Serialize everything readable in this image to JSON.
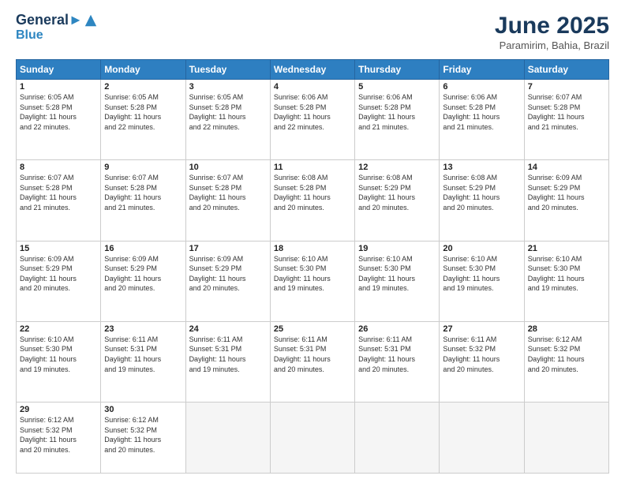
{
  "header": {
    "logo_line1": "General",
    "logo_line2": "Blue",
    "month": "June 2025",
    "location": "Paramirim, Bahia, Brazil"
  },
  "weekdays": [
    "Sunday",
    "Monday",
    "Tuesday",
    "Wednesday",
    "Thursday",
    "Friday",
    "Saturday"
  ],
  "weeks": [
    [
      {
        "day": 1,
        "info": "Sunrise: 6:05 AM\nSunset: 5:28 PM\nDaylight: 11 hours\nand 22 minutes."
      },
      {
        "day": 2,
        "info": "Sunrise: 6:05 AM\nSunset: 5:28 PM\nDaylight: 11 hours\nand 22 minutes."
      },
      {
        "day": 3,
        "info": "Sunrise: 6:05 AM\nSunset: 5:28 PM\nDaylight: 11 hours\nand 22 minutes."
      },
      {
        "day": 4,
        "info": "Sunrise: 6:06 AM\nSunset: 5:28 PM\nDaylight: 11 hours\nand 22 minutes."
      },
      {
        "day": 5,
        "info": "Sunrise: 6:06 AM\nSunset: 5:28 PM\nDaylight: 11 hours\nand 21 minutes."
      },
      {
        "day": 6,
        "info": "Sunrise: 6:06 AM\nSunset: 5:28 PM\nDaylight: 11 hours\nand 21 minutes."
      },
      {
        "day": 7,
        "info": "Sunrise: 6:07 AM\nSunset: 5:28 PM\nDaylight: 11 hours\nand 21 minutes."
      }
    ],
    [
      {
        "day": 8,
        "info": "Sunrise: 6:07 AM\nSunset: 5:28 PM\nDaylight: 11 hours\nand 21 minutes."
      },
      {
        "day": 9,
        "info": "Sunrise: 6:07 AM\nSunset: 5:28 PM\nDaylight: 11 hours\nand 21 minutes."
      },
      {
        "day": 10,
        "info": "Sunrise: 6:07 AM\nSunset: 5:28 PM\nDaylight: 11 hours\nand 20 minutes."
      },
      {
        "day": 11,
        "info": "Sunrise: 6:08 AM\nSunset: 5:28 PM\nDaylight: 11 hours\nand 20 minutes."
      },
      {
        "day": 12,
        "info": "Sunrise: 6:08 AM\nSunset: 5:29 PM\nDaylight: 11 hours\nand 20 minutes."
      },
      {
        "day": 13,
        "info": "Sunrise: 6:08 AM\nSunset: 5:29 PM\nDaylight: 11 hours\nand 20 minutes."
      },
      {
        "day": 14,
        "info": "Sunrise: 6:09 AM\nSunset: 5:29 PM\nDaylight: 11 hours\nand 20 minutes."
      }
    ],
    [
      {
        "day": 15,
        "info": "Sunrise: 6:09 AM\nSunset: 5:29 PM\nDaylight: 11 hours\nand 20 minutes."
      },
      {
        "day": 16,
        "info": "Sunrise: 6:09 AM\nSunset: 5:29 PM\nDaylight: 11 hours\nand 20 minutes."
      },
      {
        "day": 17,
        "info": "Sunrise: 6:09 AM\nSunset: 5:29 PM\nDaylight: 11 hours\nand 20 minutes."
      },
      {
        "day": 18,
        "info": "Sunrise: 6:10 AM\nSunset: 5:30 PM\nDaylight: 11 hours\nand 19 minutes."
      },
      {
        "day": 19,
        "info": "Sunrise: 6:10 AM\nSunset: 5:30 PM\nDaylight: 11 hours\nand 19 minutes."
      },
      {
        "day": 20,
        "info": "Sunrise: 6:10 AM\nSunset: 5:30 PM\nDaylight: 11 hours\nand 19 minutes."
      },
      {
        "day": 21,
        "info": "Sunrise: 6:10 AM\nSunset: 5:30 PM\nDaylight: 11 hours\nand 19 minutes."
      }
    ],
    [
      {
        "day": 22,
        "info": "Sunrise: 6:10 AM\nSunset: 5:30 PM\nDaylight: 11 hours\nand 19 minutes."
      },
      {
        "day": 23,
        "info": "Sunrise: 6:11 AM\nSunset: 5:31 PM\nDaylight: 11 hours\nand 19 minutes."
      },
      {
        "day": 24,
        "info": "Sunrise: 6:11 AM\nSunset: 5:31 PM\nDaylight: 11 hours\nand 19 minutes."
      },
      {
        "day": 25,
        "info": "Sunrise: 6:11 AM\nSunset: 5:31 PM\nDaylight: 11 hours\nand 20 minutes."
      },
      {
        "day": 26,
        "info": "Sunrise: 6:11 AM\nSunset: 5:31 PM\nDaylight: 11 hours\nand 20 minutes."
      },
      {
        "day": 27,
        "info": "Sunrise: 6:11 AM\nSunset: 5:32 PM\nDaylight: 11 hours\nand 20 minutes."
      },
      {
        "day": 28,
        "info": "Sunrise: 6:12 AM\nSunset: 5:32 PM\nDaylight: 11 hours\nand 20 minutes."
      }
    ],
    [
      {
        "day": 29,
        "info": "Sunrise: 6:12 AM\nSunset: 5:32 PM\nDaylight: 11 hours\nand 20 minutes."
      },
      {
        "day": 30,
        "info": "Sunrise: 6:12 AM\nSunset: 5:32 PM\nDaylight: 11 hours\nand 20 minutes."
      },
      null,
      null,
      null,
      null,
      null
    ]
  ]
}
